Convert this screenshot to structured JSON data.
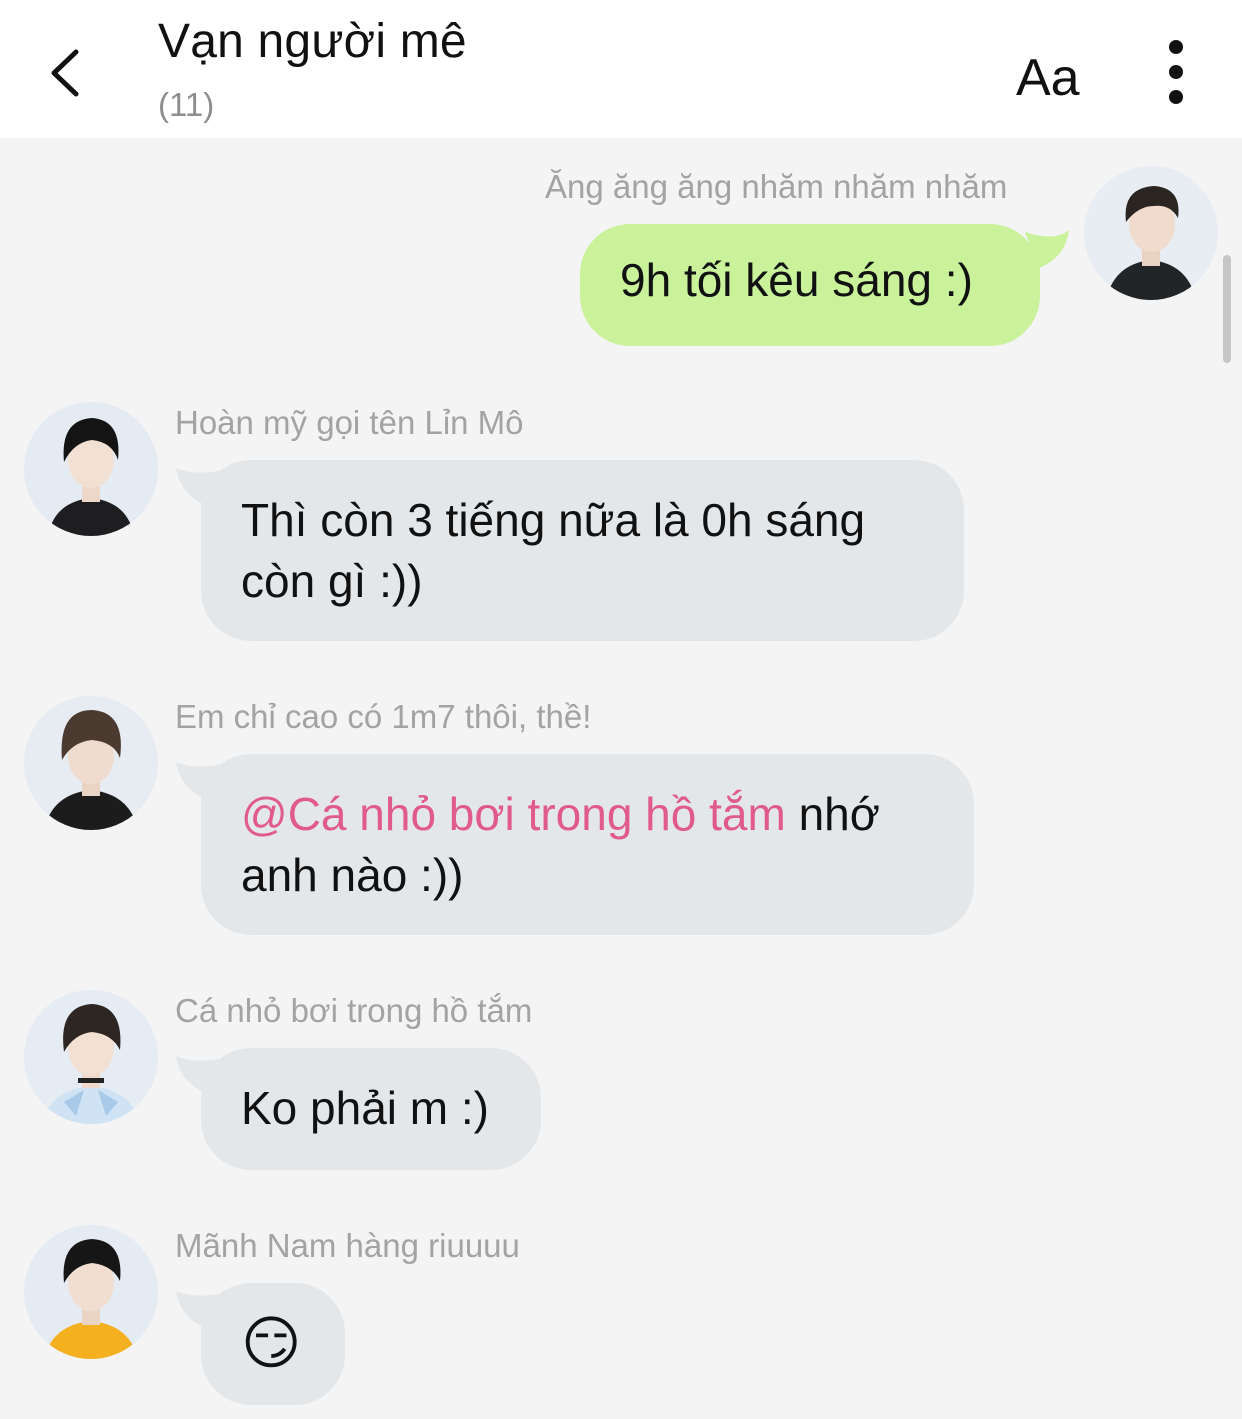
{
  "header": {
    "title": "Vạn người mê",
    "member_count": "(11)",
    "font_size_label": "Aa"
  },
  "messages": [
    {
      "sender": "Ăng ăng ăng nhăm nhăm nhăm",
      "text": "9h tối kêu sáng :)",
      "outgoing": true
    },
    {
      "sender": "Hoàn mỹ gọi tên Lỉn Mô",
      "line1": "Thì còn 3 tiếng nữa là 0h sáng",
      "line2": "còn gì :))",
      "outgoing": false
    },
    {
      "sender": "Em chỉ cao có 1m7 thôi, thề!",
      "mention": "@Cá nhỏ bơi trong hồ tắm",
      "line1_rest": " nhớ",
      "line2": "anh nào :))",
      "outgoing": false
    },
    {
      "sender": "Cá nhỏ bơi trong hồ tắm",
      "text": "Ko phải m :)",
      "outgoing": false
    },
    {
      "sender": "Mãnh Nam hàng riuuuu",
      "text": "😏",
      "outgoing": false
    }
  ],
  "colors": {
    "outgoing_bubble": "#c9f29b",
    "incoming_bubble": "#e4e7ea",
    "mention": "#e05a8a",
    "background": "#f4f4f4"
  },
  "icons": [
    "back-arrow-icon",
    "more-vertical-icon"
  ]
}
